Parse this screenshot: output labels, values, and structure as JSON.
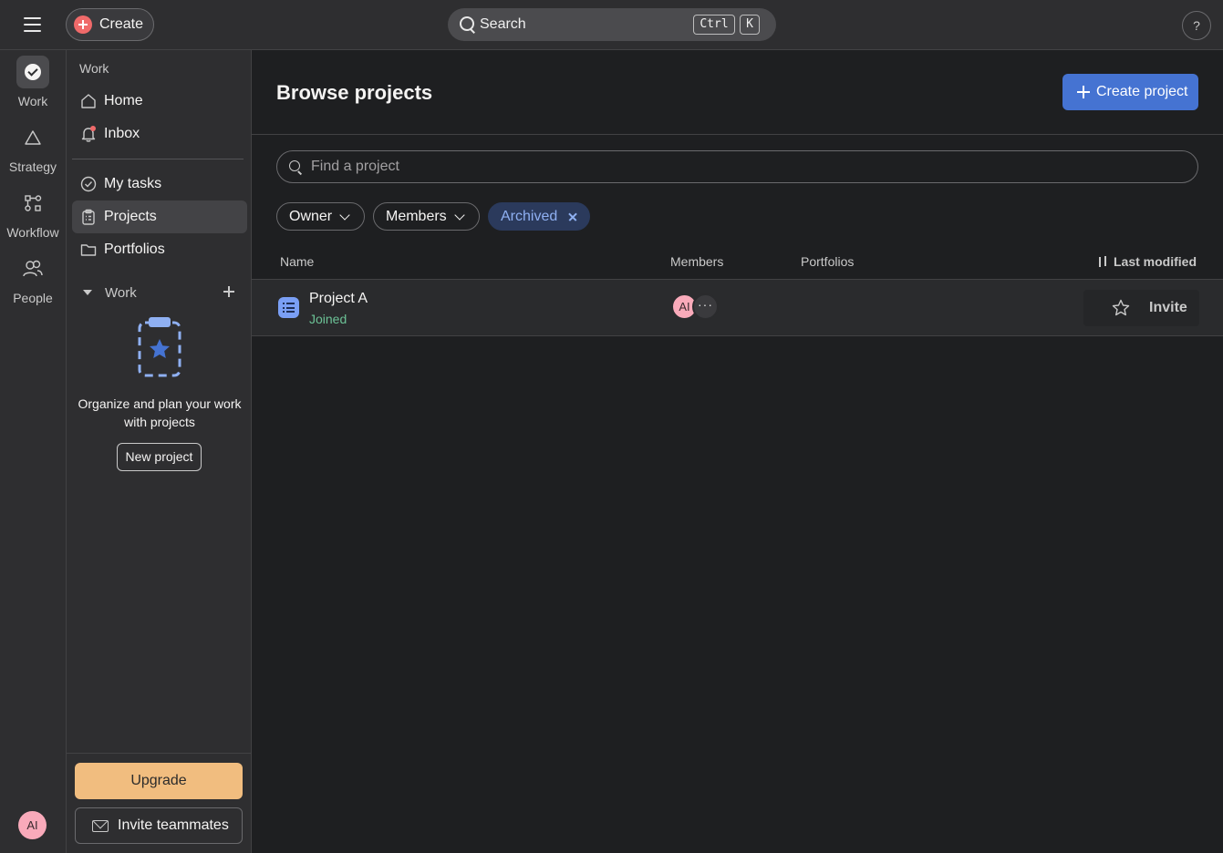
{
  "topbar": {
    "create_label": "Create",
    "search_label": "Search",
    "shortcut_ctrl": "Ctrl",
    "shortcut_key": "K",
    "help_label": "?"
  },
  "rail": {
    "items": [
      {
        "label": "Work",
        "icon": "check-circle-icon",
        "active": true
      },
      {
        "label": "Strategy",
        "icon": "triangle-icon",
        "active": false
      },
      {
        "label": "Workflow",
        "icon": "workflow-icon",
        "active": false
      },
      {
        "label": "People",
        "icon": "people-icon",
        "active": false
      }
    ],
    "avatar_initials": "AI"
  },
  "sidebar": {
    "section_label": "Work",
    "items": [
      {
        "label": "Home",
        "icon": "home-icon"
      },
      {
        "label": "Inbox",
        "icon": "bell-icon"
      },
      {
        "label": "My tasks",
        "icon": "check-circle-outline-icon"
      },
      {
        "label": "Projects",
        "icon": "clipboard-icon",
        "active": true
      },
      {
        "label": "Portfolios",
        "icon": "folder-icon"
      }
    ],
    "work_group_label": "Work",
    "empty_state_text": "Organize and plan your work with projects",
    "new_project_label": "New project",
    "upgrade_label": "Upgrade",
    "invite_teammates_label": "Invite teammates"
  },
  "main": {
    "title": "Browse projects",
    "create_project_label": "Create project",
    "find_placeholder": "Find a project",
    "filters": {
      "owner": "Owner",
      "members": "Members",
      "archived": "Archived"
    },
    "columns": {
      "name": "Name",
      "members": "Members",
      "portfolios": "Portfolios",
      "last_modified": "Last modified"
    },
    "projects": [
      {
        "name": "Project A",
        "status": "Joined",
        "member_initials": "AI",
        "more_label": "···",
        "invite_label": "Invite"
      }
    ]
  },
  "colors": {
    "accent": "#4573d2",
    "upgrade": "#f1bd7f",
    "avatar": "#f9aaba",
    "joined": "#6cc296",
    "notification": "#f06a6a"
  }
}
